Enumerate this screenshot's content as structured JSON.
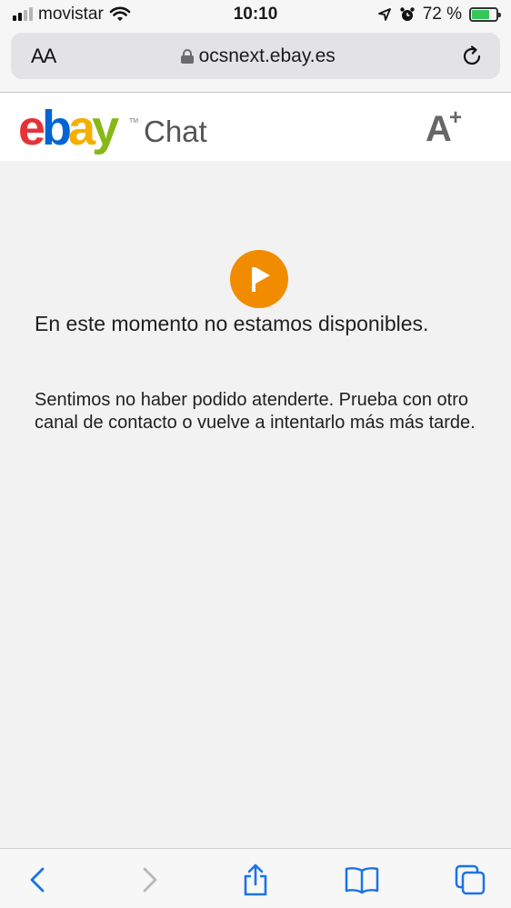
{
  "status_bar": {
    "carrier": "movistar",
    "time": "10:10",
    "battery": "72 %",
    "battery_level": 0.72
  },
  "browser": {
    "text_size_label": "AA",
    "url": "ocsnext.ebay.es"
  },
  "header": {
    "logo": "ebay",
    "logo_tm": "TM",
    "title": "Chat"
  },
  "content": {
    "heading": "En este momento no estamos disponibles.",
    "message": "Sentimos no haber podido atenderte. Prueba con otro canal de contacto o vuelve a intentarlo más más tarde."
  },
  "colors": {
    "status_icon": "#f18c00",
    "link_blue": "#1a73e8",
    "ebay_red": "#e53238",
    "ebay_blue": "#0064d2",
    "ebay_yellow": "#f5af02",
    "ebay_green": "#86b817"
  },
  "icons": {
    "status": "flag-icon",
    "back": "chevron-left-icon",
    "forward": "chevron-right-icon",
    "share": "share-icon",
    "bookmarks": "book-icon",
    "tabs": "tabs-icon",
    "reload": "reload-icon",
    "lock": "lock-icon"
  }
}
